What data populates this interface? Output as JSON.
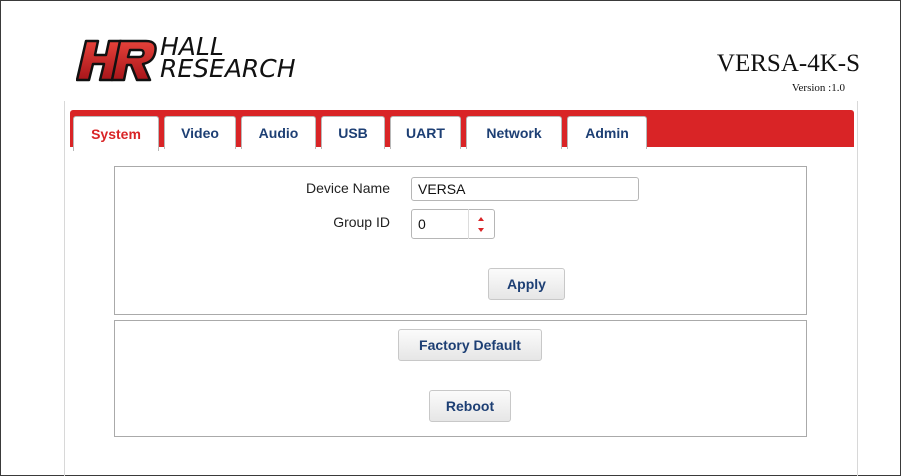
{
  "header": {
    "brand_line1": "HALL",
    "brand_line2": "RESEARCH",
    "product": "VERSA-4K-S",
    "version": "Version :1.0"
  },
  "tabs": [
    {
      "label": "System",
      "active": true
    },
    {
      "label": "Video",
      "active": false
    },
    {
      "label": "Audio",
      "active": false
    },
    {
      "label": "USB",
      "active": false
    },
    {
      "label": "UART",
      "active": false
    },
    {
      "label": "Network",
      "active": false
    },
    {
      "label": "Admin",
      "active": false
    }
  ],
  "system": {
    "device_name_label": "Device Name",
    "device_name_value": "VERSA",
    "group_id_label": "Group ID",
    "group_id_value": "0",
    "apply_label": "Apply",
    "factory_default_label": "Factory Default",
    "reboot_label": "Reboot"
  },
  "colors": {
    "accent_red": "#d92426",
    "tab_text": "#1d3f74"
  }
}
